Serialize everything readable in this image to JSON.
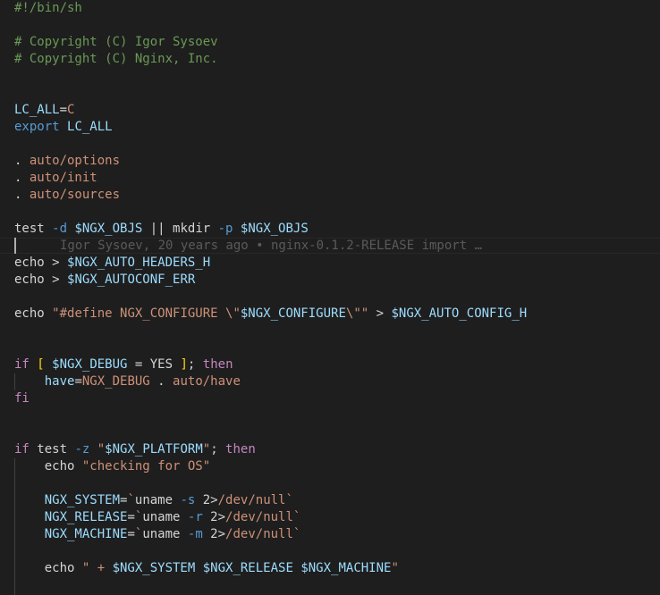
{
  "editor": {
    "language": "shell",
    "colors": {
      "background": "#1e1e1e",
      "comment": "#6a9955",
      "variable": "#9cdcfe",
      "string": "#ce9178",
      "keyword": "#569cd6",
      "control": "#c586c0",
      "bracket": "#ffd700",
      "plain": "#d4d4d4"
    },
    "blame_annotation": "Igor Sysoev, 20 years ago • nginx-0.1.2-RELEASE import …",
    "lines": [
      {
        "tokens": [
          {
            "c": "t-comment",
            "t": "#!/bin/sh"
          }
        ]
      },
      {
        "tokens": []
      },
      {
        "tokens": [
          {
            "c": "t-comment",
            "t": "# Copyright (C) Igor Sysoev"
          }
        ]
      },
      {
        "tokens": [
          {
            "c": "t-comment",
            "t": "# Copyright (C) Nginx, Inc."
          }
        ]
      },
      {
        "tokens": []
      },
      {
        "tokens": []
      },
      {
        "tokens": [
          {
            "c": "t-var",
            "t": "LC_ALL"
          },
          {
            "c": "t-plain",
            "t": "="
          },
          {
            "c": "t-str",
            "t": "C"
          }
        ]
      },
      {
        "tokens": [
          {
            "c": "t-keyword",
            "t": "export"
          },
          {
            "c": "t-plain",
            "t": " "
          },
          {
            "c": "t-var",
            "t": "LC_ALL"
          }
        ]
      },
      {
        "tokens": []
      },
      {
        "tokens": [
          {
            "c": "t-plain",
            "t": ". "
          },
          {
            "c": "t-str",
            "t": "auto/options"
          }
        ]
      },
      {
        "tokens": [
          {
            "c": "t-plain",
            "t": ". "
          },
          {
            "c": "t-str",
            "t": "auto/init"
          }
        ]
      },
      {
        "tokens": [
          {
            "c": "t-plain",
            "t": ". "
          },
          {
            "c": "t-str",
            "t": "auto/sources"
          }
        ]
      },
      {
        "tokens": []
      },
      {
        "tokens": [
          {
            "c": "t-plain",
            "t": "test "
          },
          {
            "c": "t-keyword",
            "t": "-d"
          },
          {
            "c": "t-plain",
            "t": " "
          },
          {
            "c": "t-var",
            "t": "$NGX_OBJS"
          },
          {
            "c": "t-plain",
            "t": " || mkdir "
          },
          {
            "c": "t-keyword",
            "t": "-p"
          },
          {
            "c": "t-plain",
            "t": " "
          },
          {
            "c": "t-var",
            "t": "$NGX_OBJS"
          }
        ]
      },
      {
        "tokens": []
      },
      {
        "tokens": [
          {
            "c": "t-plain",
            "t": "echo > "
          },
          {
            "c": "t-var",
            "t": "$NGX_AUTO_HEADERS_H"
          }
        ]
      },
      {
        "tokens": [
          {
            "c": "t-plain",
            "t": "echo > "
          },
          {
            "c": "t-var",
            "t": "$NGX_AUTOCONF_ERR"
          }
        ]
      },
      {
        "tokens": []
      },
      {
        "tokens": [
          {
            "c": "t-plain",
            "t": "echo "
          },
          {
            "c": "t-str",
            "t": "\"#define NGX_CONFIGURE \\\""
          },
          {
            "c": "t-var",
            "t": "$NGX_CONFIGURE"
          },
          {
            "c": "t-str",
            "t": "\\\"\""
          },
          {
            "c": "t-plain",
            "t": " > "
          },
          {
            "c": "t-var",
            "t": "$NGX_AUTO_CONFIG_H"
          }
        ]
      },
      {
        "tokens": []
      },
      {
        "tokens": []
      },
      {
        "tokens": [
          {
            "c": "t-control",
            "t": "if"
          },
          {
            "c": "t-plain",
            "t": " "
          },
          {
            "c": "t-bracket",
            "t": "["
          },
          {
            "c": "t-plain",
            "t": " "
          },
          {
            "c": "t-var",
            "t": "$NGX_DEBUG"
          },
          {
            "c": "t-plain",
            "t": " = YES "
          },
          {
            "c": "t-bracket",
            "t": "]"
          },
          {
            "c": "t-plain",
            "t": "; "
          },
          {
            "c": "t-control",
            "t": "then"
          }
        ]
      },
      {
        "tokens": [
          {
            "c": "t-plain",
            "t": "    "
          },
          {
            "c": "t-var",
            "t": "have"
          },
          {
            "c": "t-plain",
            "t": "="
          },
          {
            "c": "t-str",
            "t": "NGX_DEBUG"
          },
          {
            "c": "t-plain",
            "t": " . "
          },
          {
            "c": "t-str",
            "t": "auto/have"
          }
        ]
      },
      {
        "tokens": [
          {
            "c": "t-control",
            "t": "fi"
          }
        ]
      },
      {
        "tokens": []
      },
      {
        "tokens": []
      },
      {
        "tokens": [
          {
            "c": "t-control",
            "t": "if"
          },
          {
            "c": "t-plain",
            "t": " test "
          },
          {
            "c": "t-keyword",
            "t": "-z"
          },
          {
            "c": "t-plain",
            "t": " "
          },
          {
            "c": "t-str",
            "t": "\""
          },
          {
            "c": "t-var",
            "t": "$NGX_PLATFORM"
          },
          {
            "c": "t-str",
            "t": "\""
          },
          {
            "c": "t-plain",
            "t": "; "
          },
          {
            "c": "t-control",
            "t": "then"
          }
        ]
      },
      {
        "tokens": [
          {
            "c": "t-plain",
            "t": "    echo "
          },
          {
            "c": "t-str",
            "t": "\"checking for OS\""
          }
        ]
      },
      {
        "tokens": []
      },
      {
        "tokens": [
          {
            "c": "t-plain",
            "t": "    "
          },
          {
            "c": "t-var",
            "t": "NGX_SYSTEM"
          },
          {
            "c": "t-plain",
            "t": "="
          },
          {
            "c": "t-str",
            "t": "`"
          },
          {
            "c": "t-plain",
            "t": "uname "
          },
          {
            "c": "t-keyword",
            "t": "-s"
          },
          {
            "c": "t-plain",
            "t": " 2>"
          },
          {
            "c": "t-str",
            "t": "/dev/null`"
          }
        ]
      },
      {
        "tokens": [
          {
            "c": "t-plain",
            "t": "    "
          },
          {
            "c": "t-var",
            "t": "NGX_RELEASE"
          },
          {
            "c": "t-plain",
            "t": "="
          },
          {
            "c": "t-str",
            "t": "`"
          },
          {
            "c": "t-plain",
            "t": "uname "
          },
          {
            "c": "t-keyword",
            "t": "-r"
          },
          {
            "c": "t-plain",
            "t": " 2>"
          },
          {
            "c": "t-str",
            "t": "/dev/null`"
          }
        ]
      },
      {
        "tokens": [
          {
            "c": "t-plain",
            "t": "    "
          },
          {
            "c": "t-var",
            "t": "NGX_MACHINE"
          },
          {
            "c": "t-plain",
            "t": "="
          },
          {
            "c": "t-str",
            "t": "`"
          },
          {
            "c": "t-plain",
            "t": "uname "
          },
          {
            "c": "t-keyword",
            "t": "-m"
          },
          {
            "c": "t-plain",
            "t": " 2>"
          },
          {
            "c": "t-str",
            "t": "/dev/null`"
          }
        ]
      },
      {
        "tokens": []
      },
      {
        "tokens": [
          {
            "c": "t-plain",
            "t": "    echo "
          },
          {
            "c": "t-str",
            "t": "\" + "
          },
          {
            "c": "t-var",
            "t": "$NGX_SYSTEM"
          },
          {
            "c": "t-str",
            "t": " "
          },
          {
            "c": "t-var",
            "t": "$NGX_RELEASE"
          },
          {
            "c": "t-str",
            "t": " "
          },
          {
            "c": "t-var",
            "t": "$NGX_MACHINE"
          },
          {
            "c": "t-str",
            "t": "\""
          }
        ]
      }
    ]
  }
}
